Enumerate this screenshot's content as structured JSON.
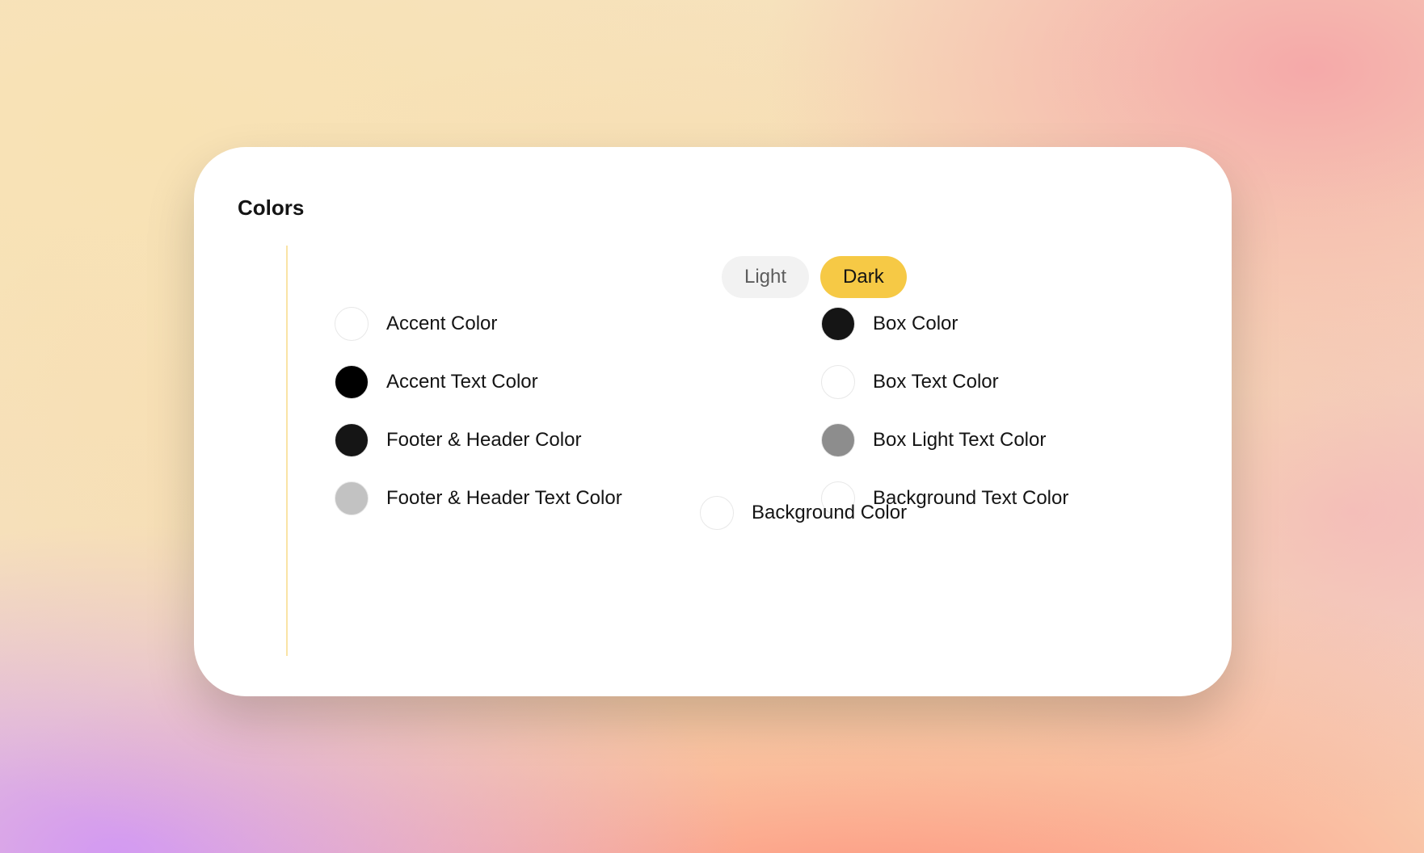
{
  "heading": "Colors",
  "toggle": {
    "light": "Light",
    "dark": "Dark",
    "active": "dark"
  },
  "left": [
    {
      "label": "Accent Color",
      "swatch": "#ffffff"
    },
    {
      "label": "Accent Text Color",
      "swatch": "#000000"
    },
    {
      "label": "Footer & Header Color",
      "swatch": "#151515"
    },
    {
      "label": "Footer & Header Text Color",
      "swatch": "#c2c2c2"
    }
  ],
  "right": [
    {
      "label": "Box Color",
      "swatch": "#151515"
    },
    {
      "label": "Box Text Color",
      "swatch": "#ffffff"
    },
    {
      "label": "Box Light Text Color",
      "swatch": "#8d8d8d"
    },
    {
      "label": "Background Text Color",
      "swatch": "#ffffff"
    }
  ],
  "background": {
    "label": "Background Color",
    "swatch": "#ffffff"
  }
}
